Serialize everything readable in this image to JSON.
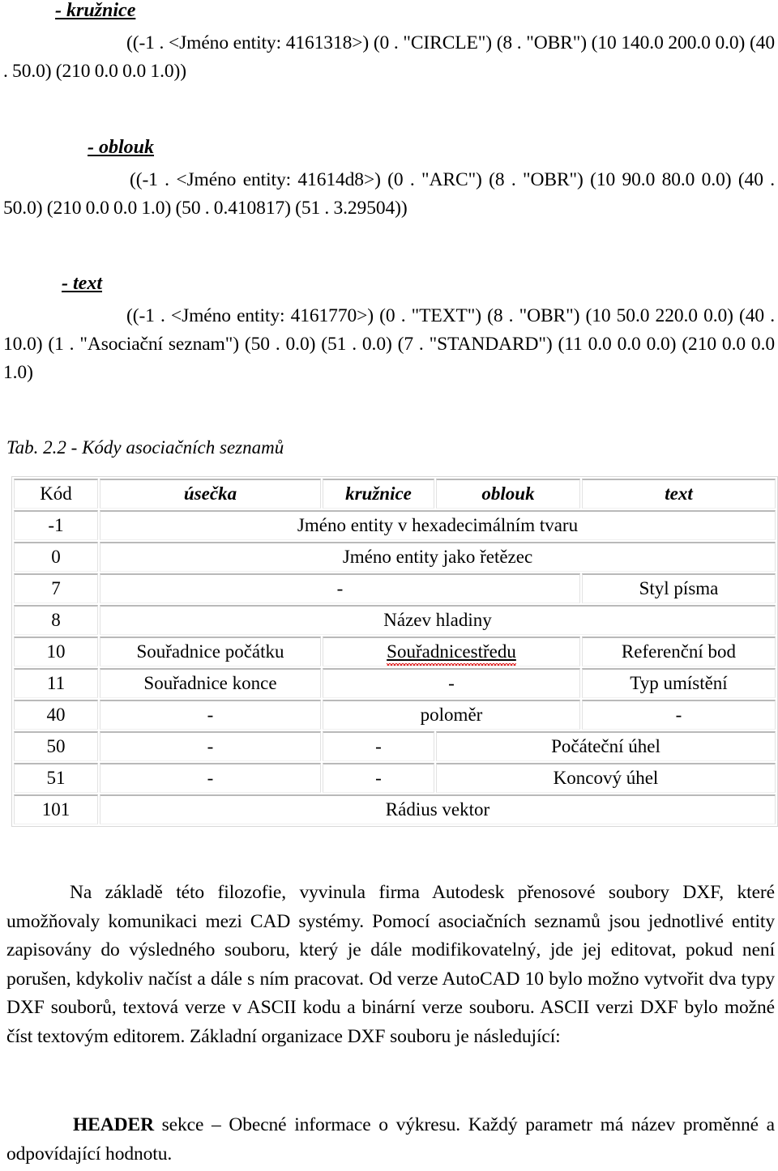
{
  "document": {
    "language": "cs",
    "sections": {
      "circle": {
        "heading": "- kružnice",
        "code": "((-1 . <Jméno entity: 4161318>) (0 . \"CIRCLE\") (8 . \"OBR\") (10 140.0 200.0 0.0) (40 . 50.0) (210 0.0 0.0 1.0))"
      },
      "arc": {
        "heading": "- oblouk",
        "code": "((-1 . <Jméno entity: 41614d8>) (0 . \"ARC\") (8 . \"OBR\") (10 90.0 80.0 0.0) (40 . 50.0) (210 0.0 0.0 1.0) (50 . 0.410817) (51 . 3.29504))"
      },
      "text": {
        "heading": "- text",
        "code": "((-1 . <Jméno entity: 4161770>) (0 . \"TEXT\") (8 . \"OBR\") (10 50.0 220.0 0.0) (40 . 10.0) (1 . \"Asociační seznam\") (50 . 0.0)  (51 . 0.0) (7 . \"STANDARD\") (11 0.0 0.0 0.0) (210 0.0 0.0 1.0)"
      }
    },
    "table_caption": "Tab.  2.2 - Kódy asociačních seznamů",
    "table": {
      "headers": [
        "Kód",
        "úsečka",
        "kružnice",
        "oblouk",
        "text"
      ],
      "rows": [
        {
          "code": "-1",
          "cells": [
            {
              "text": "Jméno entity v hexadecimálním tvaru",
              "span": 4
            }
          ]
        },
        {
          "code": "0",
          "cells": [
            {
              "text": "Jméno entity jako řetězec",
              "span": 4
            }
          ]
        },
        {
          "code": "7",
          "cells": [
            {
              "text": "-",
              "span": 3
            },
            {
              "text": "Styl písma",
              "span": 1
            }
          ]
        },
        {
          "code": "8",
          "cells": [
            {
              "text": "Název hladiny",
              "span": 4
            }
          ]
        },
        {
          "code": "10",
          "cells": [
            {
              "text": "Souřadnice počátku",
              "span": 1
            },
            {
              "text": "Souřadnicestředu",
              "span": 2,
              "spellcheck_error": true
            },
            {
              "text": "Referenční bod",
              "span": 1
            }
          ]
        },
        {
          "code": "11",
          "cells": [
            {
              "text": "Souřadnice konce",
              "span": 1
            },
            {
              "text": "-",
              "span": 2
            },
            {
              "text": "Typ umístění",
              "span": 1
            }
          ]
        },
        {
          "code": "40",
          "cells": [
            {
              "text": "-",
              "span": 1
            },
            {
              "text": "poloměr",
              "span": 2
            },
            {
              "text": "-",
              "span": 1
            }
          ]
        },
        {
          "code": "50",
          "cells": [
            {
              "text": "-",
              "span": 1
            },
            {
              "text": "-",
              "span": 1
            },
            {
              "text": "Počáteční úhel",
              "span": 2
            }
          ]
        },
        {
          "code": "51",
          "cells": [
            {
              "text": "-",
              "span": 1
            },
            {
              "text": "-",
              "span": 1
            },
            {
              "text": "Koncový úhel",
              "span": 2
            }
          ]
        },
        {
          "code": "101",
          "cells": [
            {
              "text": "Rádius vektor",
              "span": 4
            }
          ]
        }
      ]
    },
    "paragraphs": {
      "main": "Na základě této filozofie, vyvinula firma Autodesk přenosové soubory DXF, které umožňovaly komunikaci mezi CAD systémy. Pomocí asociačních seznamů jsou jednotlivé entity zapisovány do výsledného souboru, který je dále modifikovatelný, jde jej editovat, pokud není porušen, kdykoliv načíst a dále s ním pracovat. Od verze AutoCAD 10 bylo možno vytvořit dva typy DXF souborů, textová verze v ASCII kodu a binární verze souboru. ASCII verzi DXF bylo možné číst textovým editorem. Základní organizace DXF souboru je následující:",
      "header_section_label": "HEADER",
      "header_section_rest": " sekce – Obecné informace o výkresu. Každý parametr má název proměnné a odpovídající hodnotu."
    },
    "colors": {
      "text": "#000000",
      "table_border_dark": "#b9b9b9",
      "table_border_light": "#e2e2e2",
      "spellcheck_underline": "#e02020",
      "page_background": "#ffffff"
    }
  }
}
